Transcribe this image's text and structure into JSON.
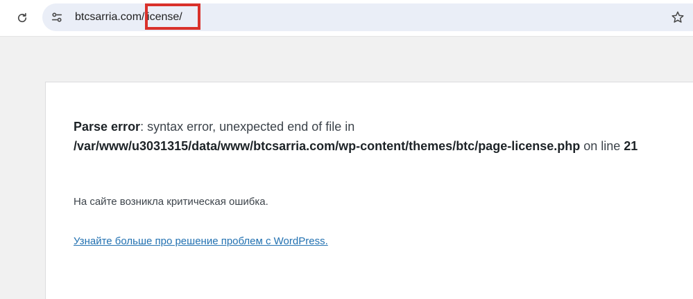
{
  "browser": {
    "reload_icon": "reload-icon",
    "site_settings_icon": "tune-icon",
    "bookmark_icon": "star-icon",
    "url": {
      "domain": "btcsarria.com",
      "path": "/license/"
    },
    "highlight_color": "#d9312b"
  },
  "error": {
    "label": "Parse error",
    "message": ": syntax error, unexpected end of file in",
    "file": "/var/www/u3031315/data/www/btcsarria.com/wp-content/themes/btc/page-license.php",
    "on_text": " on line ",
    "line": "21",
    "notice": "На сайте возникла критическая ошибка.",
    "help_link": "Узнайте больше про решение проблем с WordPress."
  }
}
